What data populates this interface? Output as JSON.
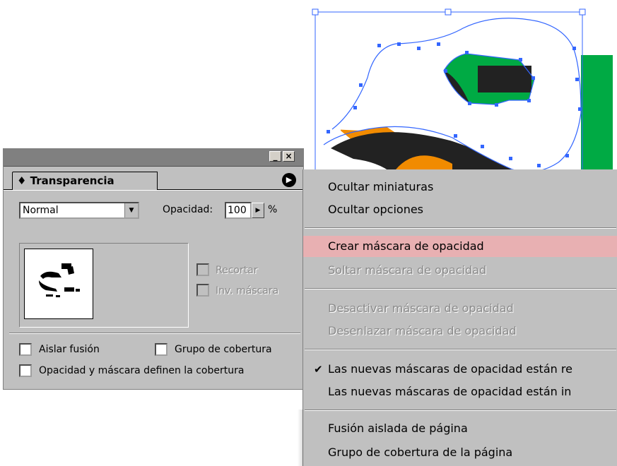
{
  "colors": {
    "panel_bg": "#c0c0c0",
    "highlight": "#e8b0b2",
    "art_green": "#00aa44",
    "art_orange": "#f18b00",
    "art_dark": "#222222",
    "selection": "#3366ff"
  },
  "panel": {
    "title_buttons": {
      "minimize_icon": "minimize-icon",
      "close_icon": "close-icon"
    },
    "tab_label": "♦ Transparencia",
    "menu_icon": "menu-arrow-icon",
    "blend_mode": "Normal",
    "opacity_label": "Opacidad:",
    "opacity_value": "100",
    "opacity_unit": "%",
    "clip_label": "Recortar",
    "invert_label": "Inv. máscara",
    "isolate_label": "Aislar fusión",
    "knockout_label": "Grupo de cobertura",
    "define_label": "Opacidad y máscara definen la cobertura"
  },
  "menu": {
    "items": [
      {
        "label": "Ocultar miniaturas",
        "enabled": true
      },
      {
        "label": "Ocultar opciones",
        "enabled": true
      },
      {
        "label": "Crear máscara de opacidad",
        "enabled": true,
        "highlighted": true
      },
      {
        "label": "Soltar máscara de opacidad",
        "enabled": false
      },
      {
        "label": "Desactivar máscara de opacidad",
        "enabled": false
      },
      {
        "label": "Desenlazar máscara de opacidad",
        "enabled": false
      },
      {
        "label": "Las nuevas máscaras de opacidad están re",
        "enabled": true,
        "checked": true
      },
      {
        "label": "Las nuevas máscaras de opacidad están in",
        "enabled": true
      },
      {
        "label": "Fusión aislada de página",
        "enabled": true
      },
      {
        "label": "Grupo de cobertura de la página",
        "enabled": true
      }
    ]
  }
}
